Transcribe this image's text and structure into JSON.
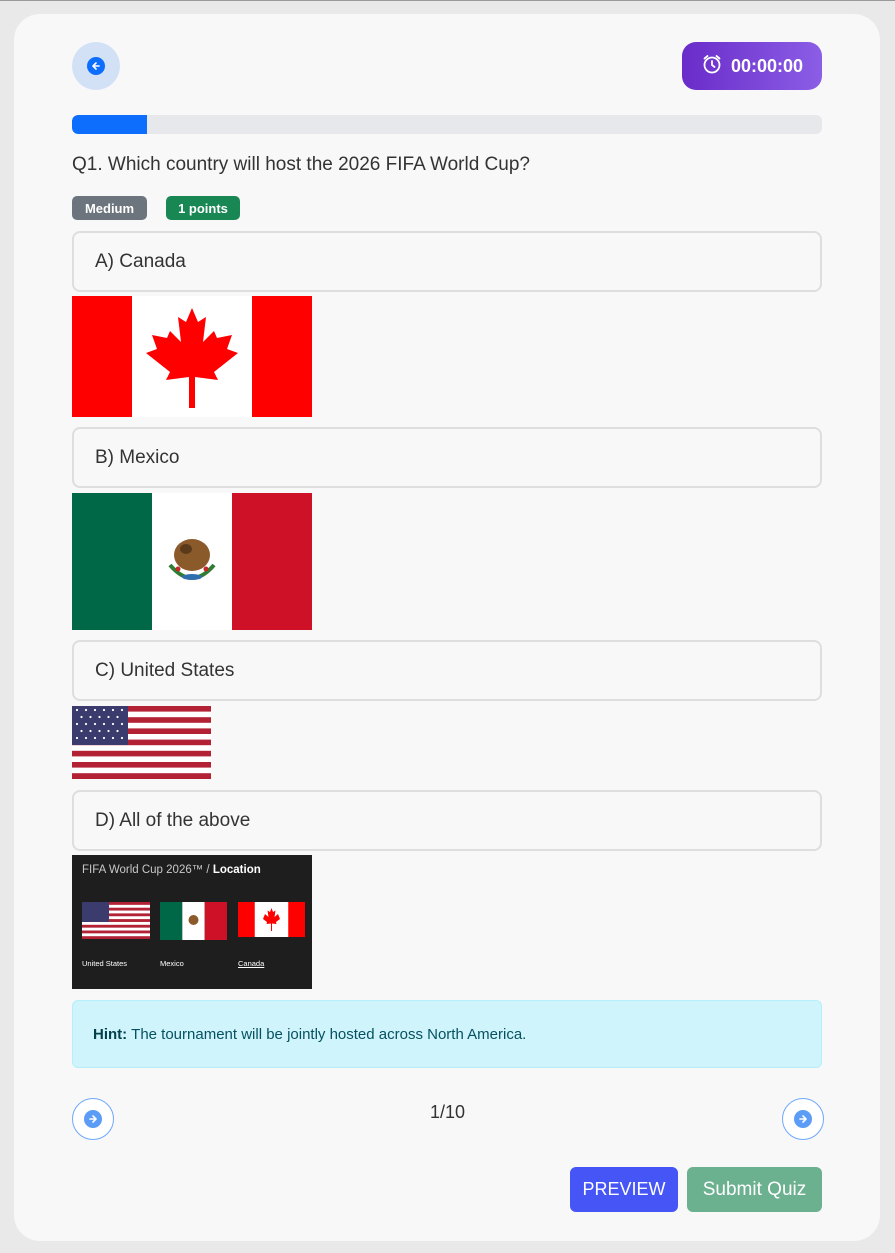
{
  "header": {
    "back_icon": "arrow-left-circle-icon",
    "timer_icon": "alarm-clock-icon",
    "timer_value": "00:00:00"
  },
  "progress": {
    "fraction": 0.1
  },
  "question": {
    "text": "Q1. Which country will host the 2026 FIFA World Cup?",
    "difficulty": "Medium",
    "points": "1 points"
  },
  "options": [
    {
      "label": "A) Canada",
      "image": "canada-flag"
    },
    {
      "label": "B) Mexico",
      "image": "mexico-flag"
    },
    {
      "label": "C) United States",
      "image": "usa-flag"
    },
    {
      "label": "D) All of the above",
      "image": "world-cup-hosts-image"
    }
  ],
  "hosts_image": {
    "title_prefix": "FIFA World Cup 2026™ / ",
    "title_bold": "Location",
    "captions": [
      "United States",
      "Mexico",
      "Canada"
    ]
  },
  "hint": {
    "label": "Hint:",
    "text": "The tournament will be jointly hosted across North America."
  },
  "pagination": {
    "current": "1/10",
    "prev_icon": "arrow-right-circle-icon",
    "next_icon": "arrow-right-circle-icon"
  },
  "actions": {
    "preview": "PREVIEW",
    "submit": "Submit Quiz"
  },
  "colors": {
    "accent": "#0d6efd",
    "timer_gradient_start": "#6a2cc9",
    "timer_gradient_end": "#8b5ee6",
    "difficulty_badge": "#6c757d",
    "points_badge": "#198754",
    "hint_bg": "#cff4fc",
    "preview_button": "#4655f6",
    "submit_button": "#6bb08f"
  }
}
